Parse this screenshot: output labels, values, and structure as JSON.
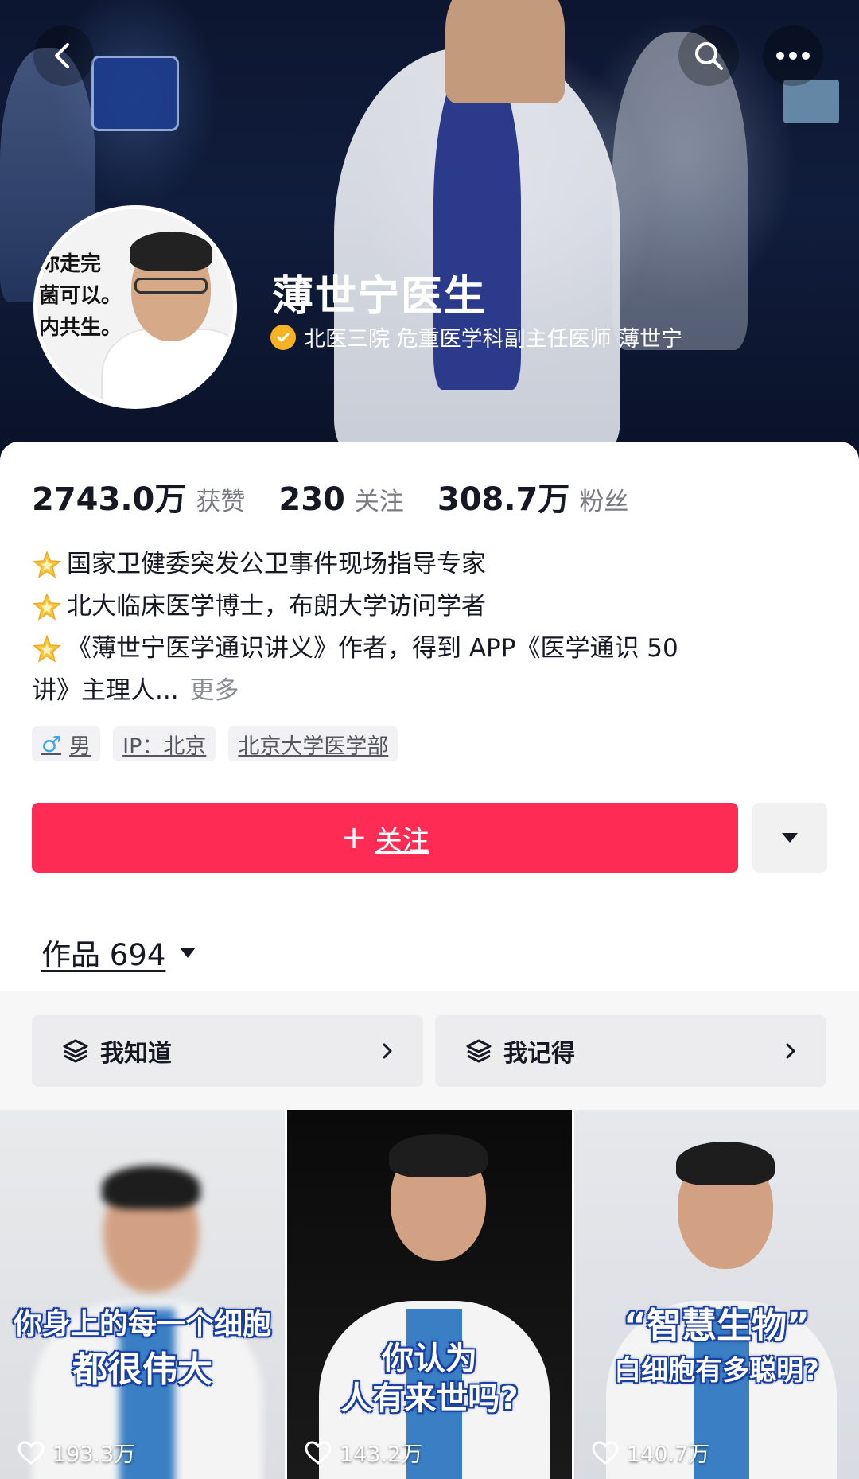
{
  "header": {
    "name": "薄世宁医生",
    "verification": "北医三院 危重医学科副主任医师 薄世宁",
    "avatar_text": [
      "你走完",
      "菌可以。",
      "内共生。"
    ]
  },
  "stats": [
    {
      "value": "2743.0万",
      "label": "获赞"
    },
    {
      "value": "230",
      "label": "关注"
    },
    {
      "value": "308.7万",
      "label": "粉丝"
    }
  ],
  "bio": {
    "line1": "国家卫健委突发公卫事件现场指导专家",
    "line2": "北大临床医学博士，布朗大学访问学者",
    "line3": "《薄世宁医学通识讲义》作者，得到 APP《医学通识 50",
    "line4": "讲》主理人...",
    "more": "更多"
  },
  "tags": {
    "gender_icon": "♂",
    "gender": "男",
    "ip": "IP：北京",
    "school": "北京大学医学部"
  },
  "follow": {
    "plus": "+",
    "label": "关注"
  },
  "works": {
    "label": "作品 694"
  },
  "collections": [
    {
      "title": "我知道"
    },
    {
      "title": "我记得"
    }
  ],
  "videos": [
    {
      "caption_top": "你身上的每一个细胞",
      "caption_bottom": "都很伟大",
      "likes": "193.3万"
    },
    {
      "caption_top": "你认为",
      "caption_bottom": "人有来世吗?",
      "likes": "143.2万"
    },
    {
      "caption_top": "“智慧生物”",
      "caption_bottom": "白细胞有多聪明?",
      "likes": "140.7万"
    }
  ],
  "colors": {
    "accent": "#fe2c55",
    "verify_badge": "#f5b324",
    "male_icon": "#3aa7e6"
  }
}
